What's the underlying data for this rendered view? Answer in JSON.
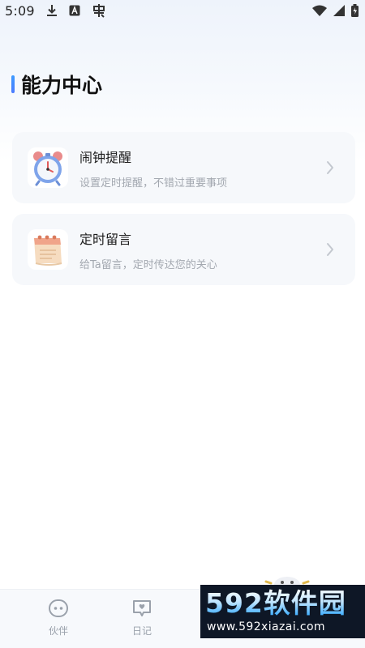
{
  "status_bar": {
    "time": "5:09",
    "left_icons": [
      "download-icon",
      "a-badge-icon",
      "bug-icon"
    ],
    "right_icons": [
      "wifi-icon",
      "cellular-signal-icon",
      "battery-icon"
    ]
  },
  "header": {
    "title": "能力中心",
    "accent_color": "#3d9bff"
  },
  "cards": [
    {
      "title": "闹钟提醒",
      "subtitle": "设置定时提醒，不错过重要事项",
      "icon": "alarm-clock-icon"
    },
    {
      "title": "定时留言",
      "subtitle": "给Ta留言，定时传达您的关心",
      "icon": "calendar-note-icon"
    }
  ],
  "bottom_nav": {
    "items": [
      {
        "label": "伙伴",
        "icon": "companion-face-icon"
      },
      {
        "label": "日记",
        "icon": "diary-chat-icon"
      }
    ]
  },
  "watermark": {
    "logo_text": "592软件园",
    "url": "www.592xiazai.com"
  },
  "colors": {
    "card_bg": "#f6f8fb",
    "subtitle": "#a3a8b0",
    "nav_bg": "#f7f9fc",
    "watermark_bg": "#0e1726"
  }
}
